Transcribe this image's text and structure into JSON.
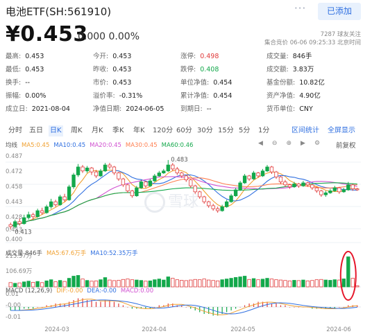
{
  "header": {
    "title": "电池ETF(SH:561910)",
    "more_icon": "more-dots-icon",
    "add_button": "已添加",
    "price": "¥0.453",
    "change": "0.000  0.00%",
    "followers": "7287 球友关注",
    "time_info": "集合竞价  06-06  09:25:33  北京时间"
  },
  "stats": [
    [
      {
        "label": "最高:",
        "value": "0.453"
      },
      {
        "label": "今开:",
        "value": "0.453"
      },
      {
        "label": "涨停:",
        "value": "0.498",
        "color": "red"
      },
      {
        "label": "成交量:",
        "value": "846手"
      }
    ],
    [
      {
        "label": "最低:",
        "value": "0.453"
      },
      {
        "label": "昨收:",
        "value": "0.453"
      },
      {
        "label": "跌停:",
        "value": "0.408",
        "color": "green"
      },
      {
        "label": "成交额:",
        "value": "3.83万"
      }
    ],
    [
      {
        "label": "换手:",
        "value": "--"
      },
      {
        "label": "市价:",
        "value": "0.453"
      },
      {
        "label": "单位净值:",
        "value": "0.454"
      },
      {
        "label": "基金份额:",
        "value": "10.82亿"
      }
    ],
    [
      {
        "label": "振幅:",
        "value": "0.00%"
      },
      {
        "label": "溢价率:",
        "value": "-0.31%"
      },
      {
        "label": "累计净值:",
        "value": "0.454"
      },
      {
        "label": "资产净值:",
        "value": "4.90亿"
      }
    ],
    [
      {
        "label": "成立日:",
        "value": "2021-08-04"
      },
      {
        "label": "净值日期:",
        "value": "2024-06-05"
      },
      {
        "label": "到期日:",
        "value": "--"
      },
      {
        "label": "货币单位:",
        "value": "CNY"
      }
    ]
  ],
  "tabs": {
    "items": [
      "分时",
      "五日",
      "日K",
      "周K",
      "月K",
      "季K",
      "年K",
      "120分",
      "60分",
      "30分",
      "15分",
      "5分",
      "1分"
    ],
    "active": "日K",
    "interval_stats": "区间统计",
    "fullscreen": "全屏显示"
  },
  "ma_legend": [
    {
      "text": "均线",
      "color": "#555555"
    },
    {
      "text": "MA5:0.45",
      "color": "#f0a030"
    },
    {
      "text": "MA10:0.45",
      "color": "#2f6fe0"
    },
    {
      "text": "MA20:0.45",
      "color": "#d050d0"
    },
    {
      "text": "MA30:0.45",
      "color": "#ff7f50"
    },
    {
      "text": "MA60:0.46",
      "color": "#13a84b"
    }
  ],
  "chart_tools": {
    "icons": [
      "arrow-left-icon",
      "minus-icon",
      "plus-icon",
      "arrow-right-icon",
      "settings-icon"
    ],
    "adjust": "前复权"
  },
  "vol_legend": [
    {
      "text": "成交量 846手",
      "color": "#555555"
    },
    {
      "text": "MA5:67.6万手",
      "color": "#f0a030"
    },
    {
      "text": "MA10:52.35万手",
      "color": "#2f6fe0"
    }
  ],
  "macd_legend": [
    {
      "text": "MACD (12,26,9)",
      "color": "#555555"
    },
    {
      "text": "DIF:-0.00",
      "color": "#f0a030"
    },
    {
      "text": "DEA:-0.00",
      "color": "#2f6fe0"
    },
    {
      "text": "MACD:0.00",
      "color": "#d050d0"
    }
  ],
  "watermark": "雪球",
  "chart_data": {
    "type": "candlestick",
    "price_axis": {
      "ticks": [
        "0.487",
        "0.472",
        "0.458",
        "0.443",
        "0.428",
        "0.413",
        "0.400"
      ],
      "min": 0.4,
      "max": 0.492
    },
    "annotations": {
      "high": "0.483",
      "low": "0.413"
    },
    "volume_axis": {
      "ticks": [
        "213.37万",
        "106.69万"
      ]
    },
    "macd_axis": {
      "ticks": [
        "0.01",
        "-0.00",
        "-0.01"
      ]
    },
    "x_labels": [
      "2024-03",
      "2024-04",
      "2024-05",
      "2024-06"
    ],
    "candles": [
      [
        0.418,
        0.416,
        0.42,
        0.413
      ],
      [
        0.416,
        0.421,
        0.423,
        0.414
      ],
      [
        0.421,
        0.419,
        0.424,
        0.417
      ],
      [
        0.419,
        0.425,
        0.428,
        0.418
      ],
      [
        0.425,
        0.428,
        0.431,
        0.423
      ],
      [
        0.428,
        0.426,
        0.43,
        0.423
      ],
      [
        0.426,
        0.432,
        0.434,
        0.425
      ],
      [
        0.432,
        0.43,
        0.435,
        0.428
      ],
      [
        0.43,
        0.436,
        0.438,
        0.429
      ],
      [
        0.436,
        0.441,
        0.444,
        0.434
      ],
      [
        0.441,
        0.438,
        0.443,
        0.436
      ],
      [
        0.438,
        0.446,
        0.448,
        0.437
      ],
      [
        0.446,
        0.443,
        0.449,
        0.441
      ],
      [
        0.443,
        0.456,
        0.458,
        0.442
      ],
      [
        0.456,
        0.468,
        0.47,
        0.454
      ],
      [
        0.468,
        0.476,
        0.479,
        0.466
      ],
      [
        0.476,
        0.472,
        0.478,
        0.47
      ],
      [
        0.472,
        0.475,
        0.477,
        0.47
      ],
      [
        0.475,
        0.471,
        0.476,
        0.468
      ],
      [
        0.471,
        0.467,
        0.473,
        0.465
      ],
      [
        0.467,
        0.472,
        0.474,
        0.466
      ],
      [
        0.472,
        0.478,
        0.48,
        0.471
      ],
      [
        0.478,
        0.476,
        0.48,
        0.474
      ],
      [
        0.476,
        0.47,
        0.477,
        0.468
      ],
      [
        0.47,
        0.464,
        0.471,
        0.462
      ],
      [
        0.464,
        0.458,
        0.465,
        0.456
      ],
      [
        0.458,
        0.452,
        0.459,
        0.45
      ],
      [
        0.452,
        0.447,
        0.453,
        0.445
      ],
      [
        0.447,
        0.455,
        0.457,
        0.446
      ],
      [
        0.455,
        0.461,
        0.463,
        0.454
      ],
      [
        0.461,
        0.457,
        0.462,
        0.455
      ],
      [
        0.457,
        0.462,
        0.464,
        0.456
      ],
      [
        0.462,
        0.467,
        0.469,
        0.461
      ],
      [
        0.467,
        0.47,
        0.472,
        0.466
      ],
      [
        0.47,
        0.472,
        0.474,
        0.469
      ],
      [
        0.472,
        0.478,
        0.483,
        0.471
      ],
      [
        0.478,
        0.474,
        0.48,
        0.472
      ],
      [
        0.474,
        0.47,
        0.476,
        0.468
      ],
      [
        0.47,
        0.467,
        0.471,
        0.465
      ],
      [
        0.467,
        0.463,
        0.468,
        0.461
      ],
      [
        0.463,
        0.457,
        0.464,
        0.455
      ],
      [
        0.457,
        0.451,
        0.458,
        0.449
      ],
      [
        0.451,
        0.446,
        0.452,
        0.444
      ],
      [
        0.446,
        0.441,
        0.447,
        0.439
      ],
      [
        0.441,
        0.437,
        0.442,
        0.435
      ],
      [
        0.437,
        0.434,
        0.439,
        0.432
      ],
      [
        0.434,
        0.432,
        0.436,
        0.43
      ],
      [
        0.432,
        0.436,
        0.438,
        0.431
      ],
      [
        0.436,
        0.441,
        0.443,
        0.435
      ],
      [
        0.441,
        0.447,
        0.449,
        0.44
      ],
      [
        0.447,
        0.453,
        0.455,
        0.446
      ],
      [
        0.453,
        0.46,
        0.462,
        0.452
      ],
      [
        0.46,
        0.467,
        0.469,
        0.459
      ],
      [
        0.467,
        0.464,
        0.468,
        0.462
      ],
      [
        0.464,
        0.47,
        0.472,
        0.463
      ],
      [
        0.47,
        0.467,
        0.471,
        0.465
      ],
      [
        0.467,
        0.472,
        0.474,
        0.466
      ],
      [
        0.472,
        0.476,
        0.478,
        0.471
      ],
      [
        0.476,
        0.471,
        0.477,
        0.469
      ],
      [
        0.471,
        0.466,
        0.472,
        0.464
      ],
      [
        0.466,
        0.461,
        0.467,
        0.459
      ],
      [
        0.461,
        0.458,
        0.463,
        0.456
      ],
      [
        0.458,
        0.456,
        0.459,
        0.454
      ],
      [
        0.456,
        0.459,
        0.461,
        0.455
      ],
      [
        0.459,
        0.457,
        0.46,
        0.455
      ],
      [
        0.457,
        0.46,
        0.462,
        0.456
      ],
      [
        0.46,
        0.458,
        0.461,
        0.456
      ],
      [
        0.458,
        0.455,
        0.459,
        0.453
      ],
      [
        0.455,
        0.452,
        0.456,
        0.45
      ],
      [
        0.452,
        0.448,
        0.453,
        0.446
      ],
      [
        0.448,
        0.45,
        0.452,
        0.446
      ],
      [
        0.45,
        0.452,
        0.454,
        0.449
      ],
      [
        0.452,
        0.455,
        0.457,
        0.451
      ],
      [
        0.455,
        0.451,
        0.456,
        0.449
      ],
      [
        0.451,
        0.453,
        0.455,
        0.45
      ],
      [
        0.453,
        0.458,
        0.461,
        0.452
      ],
      [
        0.458,
        0.454,
        0.459,
        0.452
      ],
      [
        0.454,
        0.453,
        0.455,
        0.452
      ]
    ],
    "volumes": [
      30,
      25,
      28,
      35,
      40,
      32,
      38,
      30,
      42,
      50,
      36,
      45,
      38,
      60,
      75,
      80,
      55,
      45,
      40,
      42,
      50,
      65,
      48,
      44,
      46,
      52,
      55,
      50,
      48,
      45,
      40,
      42,
      50,
      55,
      48,
      70,
      60,
      50,
      46,
      44,
      48,
      52,
      50,
      55,
      48,
      45,
      42,
      50,
      55,
      60,
      66,
      70,
      75,
      52,
      58,
      50,
      54,
      60,
      55,
      50,
      48,
      45,
      42,
      46,
      44,
      48,
      42,
      45,
      50,
      52,
      48,
      46,
      50,
      48,
      56,
      210,
      60,
      8
    ],
    "macd": [
      -0.002,
      -0.002,
      -0.002,
      -0.001,
      -0.001,
      -0.001,
      0,
      0,
      0.001,
      0.001,
      0.002,
      0.002,
      0.002,
      0.003,
      0.004,
      0.005,
      0.005,
      0.004,
      0.004,
      0.003,
      0.003,
      0.004,
      0.004,
      0.003,
      0.002,
      0.001,
      0,
      -0.001,
      -0.001,
      -0.001,
      -0.001,
      -0.001,
      0,
      0.001,
      0.001,
      0.002,
      0.002,
      0.001,
      0.001,
      0,
      -0.001,
      -0.002,
      -0.003,
      -0.004,
      -0.004,
      -0.005,
      -0.005,
      -0.004,
      -0.003,
      -0.002,
      -0.001,
      0,
      0.001,
      0.002,
      0.002,
      0.003,
      0.003,
      0.003,
      0.002,
      0.002,
      0.001,
      0.001,
      0,
      0,
      0,
      0,
      0,
      -0.001,
      -0.001,
      -0.001,
      -0.001,
      -0.001,
      -0.001,
      0,
      0,
      0.001,
      0.001,
      0.001
    ]
  }
}
